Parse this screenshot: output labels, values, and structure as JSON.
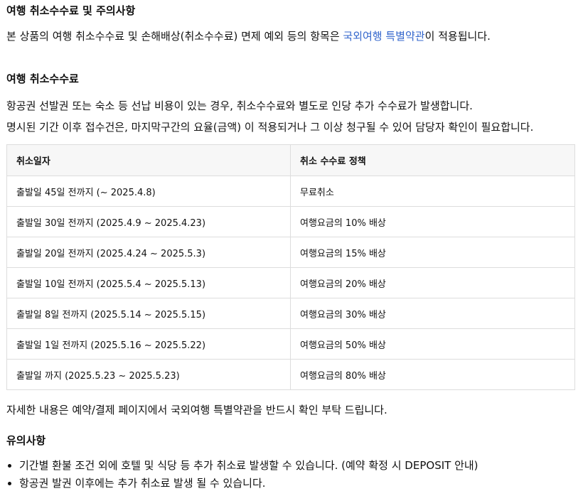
{
  "heading_main": "여행 취소수수료 및 주의사항",
  "intro": {
    "before": "본 상품의 여행 취소수수료 및 손해배상(취소수수료) 면제 예외 등의 항목은 ",
    "link": "국외여행 특별약관",
    "after": "이 적용됩니다."
  },
  "heading_fee": "여행 취소수수료",
  "para1": "항공권 선발권 또는 숙소 등 선납 비용이 있는 경우, 취소수수료와 별도로 인당 추가 수수료가 발생합니다.",
  "para2": "명시된 기간 이후 접수건은, 마지막구간의 요율(금액) 이 적용되거나 그 이상 청구될 수 있어 담당자 확인이 필요합니다.",
  "table": {
    "headers": [
      "취소일자",
      "취소 수수료 정책"
    ],
    "rows": [
      [
        "출발일 45일 전까지 (~ 2025.4.8)",
        "무료취소"
      ],
      [
        "출발일 30일 전까지 (2025.4.9 ~ 2025.4.23)",
        "여행요금의 10% 배상"
      ],
      [
        "출발일 20일 전까지 (2025.4.24 ~ 2025.5.3)",
        "여행요금의 15% 배상"
      ],
      [
        "출발일 10일 전까지 (2025.5.4 ~ 2025.5.13)",
        "여행요금의 20% 배상"
      ],
      [
        "출발일 8일 전까지 (2025.5.14 ~ 2025.5.15)",
        "여행요금의 30% 배상"
      ],
      [
        "출발일 1일 전까지 (2025.5.16 ~ 2025.5.22)",
        "여행요금의 50% 배상"
      ],
      [
        "출발일 까지 (2025.5.23 ~ 2025.5.23)",
        "여행요금의 80% 배상"
      ]
    ]
  },
  "after_table": "자세한 내용은 예약/결제 페이지에서 국외여행 특별약관을 반드시 확인 부탁 드립니다.",
  "heading_notes": "유의사항",
  "notes": [
    "기간별 환불 조건 외에 호텔 및 식당 등 추가 취소료 발생할 수 있습니다. (예약 확정 시 DEPOSIT 안내)",
    "항공권 발권 이후에는 추가 취소료 발생 될 수 있습니다."
  ]
}
